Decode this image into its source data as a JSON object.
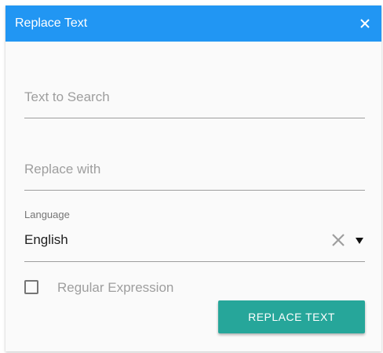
{
  "dialog": {
    "title": "Replace Text",
    "close_icon": "close-icon"
  },
  "search": {
    "placeholder": "Text to Search",
    "value": ""
  },
  "replace": {
    "placeholder": "Replace with",
    "value": ""
  },
  "language": {
    "label": "Language",
    "selected": "English",
    "clear_icon": "close-icon",
    "dropdown_icon": "chevron-down-icon"
  },
  "regex": {
    "label": "Regular Expression",
    "checked": false
  },
  "actions": {
    "replace_label": "REPLACE TEXT"
  },
  "colors": {
    "header": "#2196f3",
    "button": "#26a69a",
    "background": "#fafafa"
  }
}
